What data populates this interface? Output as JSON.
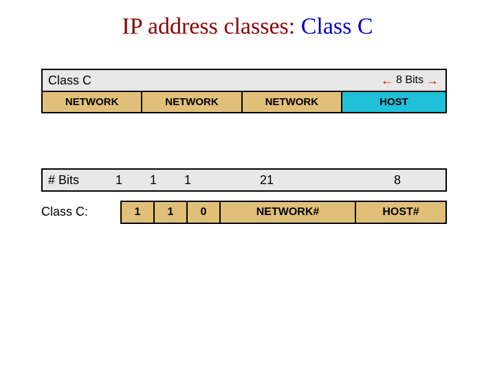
{
  "title": {
    "part1": "IP address classes: ",
    "part2": "Class C"
  },
  "panel1": {
    "heading": "Class C",
    "bits_label": "8 Bits",
    "cells": {
      "n1": "NETWORK",
      "n2": "NETWORK",
      "n3": "NETWORK",
      "host": "HOST"
    }
  },
  "panel2": {
    "label": "# Bits",
    "b1": "1",
    "b2": "1",
    "b3": "1",
    "b21": "21",
    "b8": "8"
  },
  "row3": {
    "label": "Class C:",
    "c1": "1",
    "c2": "1",
    "c3": "0",
    "net": "NETWORK#",
    "host": "HOST#"
  }
}
